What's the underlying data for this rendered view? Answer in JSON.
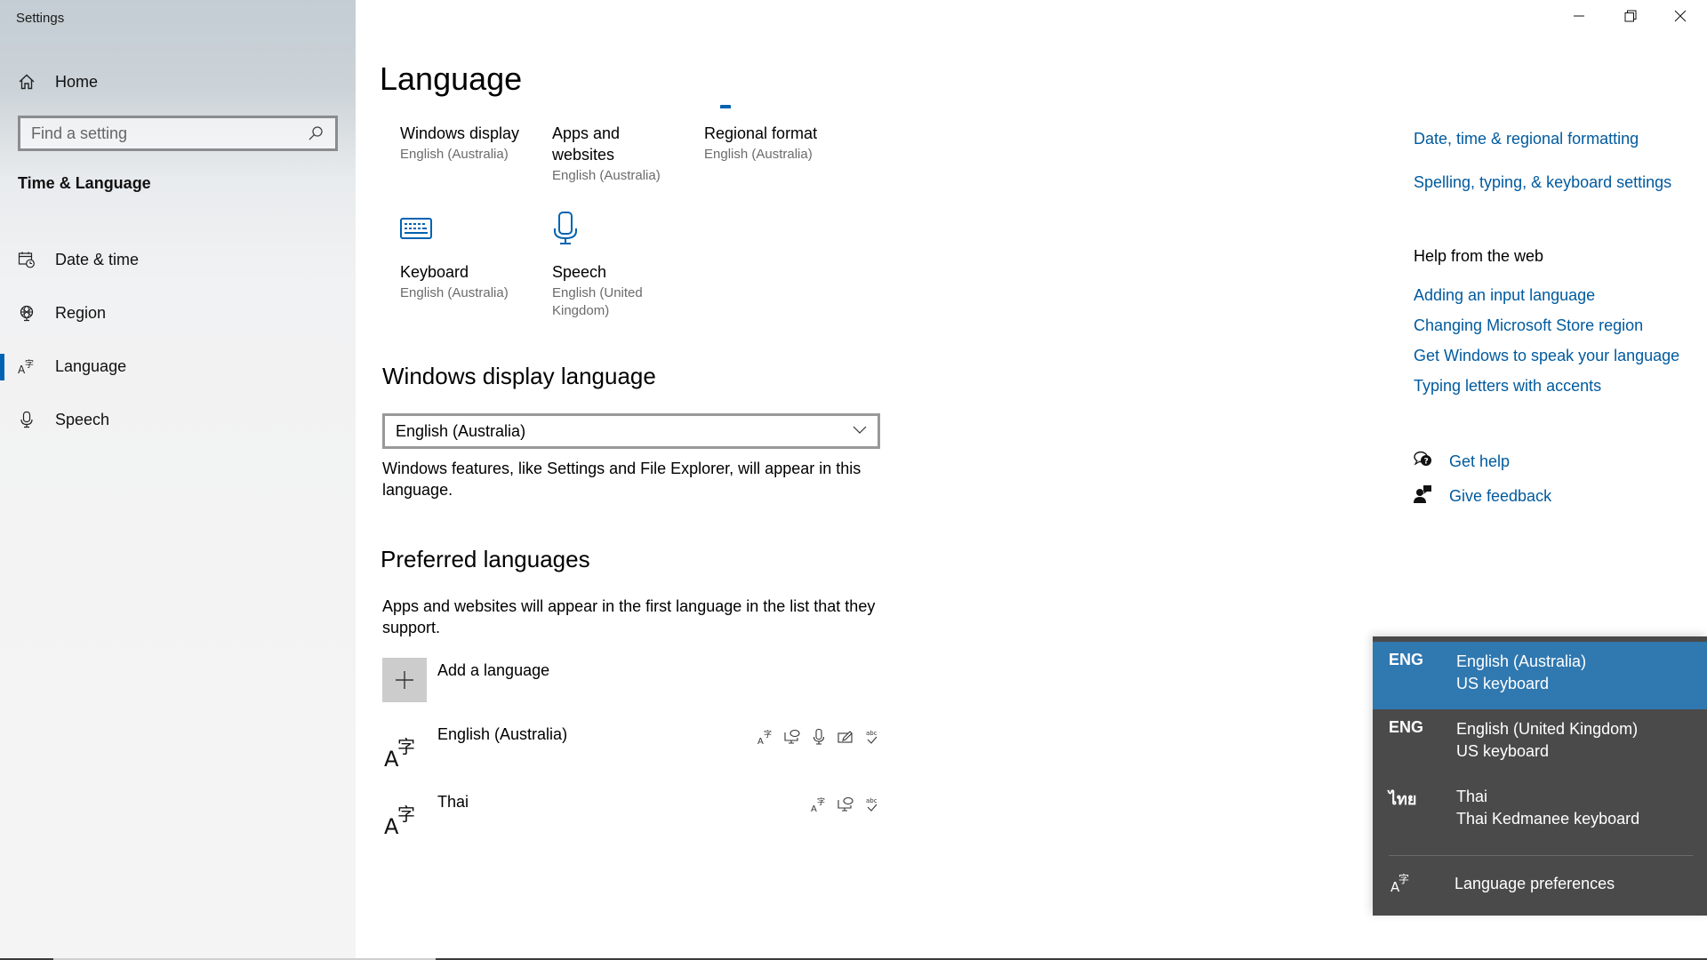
{
  "window": {
    "title": "Settings",
    "controls": {
      "minimize": "minimize-icon",
      "restore": "restore-icon",
      "close": "close-icon"
    }
  },
  "sidebar": {
    "home_label": "Home",
    "search_placeholder": "Find a setting",
    "section_title": "Time & Language",
    "items": [
      {
        "label": "Date & time",
        "icon": "calendar-clock-icon",
        "active": false
      },
      {
        "label": "Region",
        "icon": "globe-icon",
        "active": false
      },
      {
        "label": "Language",
        "icon": "language-icon",
        "active": true
      },
      {
        "label": "Speech",
        "icon": "microphone-icon",
        "active": false
      }
    ]
  },
  "main": {
    "page_title": "Language",
    "tiles": [
      {
        "title": "Windows display",
        "subtitle": "English (Australia)"
      },
      {
        "title": "Apps and websites",
        "subtitle": "English (Australia)"
      },
      {
        "title": "Regional format",
        "subtitle": "English (Australia)"
      },
      {
        "title": "Keyboard",
        "subtitle": "English (Australia)",
        "icon": "keyboard-icon"
      },
      {
        "title": "Speech",
        "subtitle": "English (United Kingdom)",
        "icon": "microphone-icon"
      }
    ],
    "display_language": {
      "heading": "Windows display language",
      "selected": "English (Australia)",
      "description": "Windows features, like Settings and File Explorer, will appear in this language."
    },
    "preferred": {
      "heading": "Preferred languages",
      "description": "Apps and websites will appear in the first language in the list that they support.",
      "add_label": "Add a language",
      "languages": [
        {
          "name": "English (Australia)",
          "features": [
            "display-language-icon",
            "text-to-speech-icon",
            "speech-recognition-icon",
            "handwriting-icon",
            "spell-check-icon"
          ]
        },
        {
          "name": "Thai",
          "features": [
            "display-language-icon",
            "text-to-speech-icon",
            "spell-check-icon"
          ]
        }
      ]
    }
  },
  "related": {
    "links": [
      "Date, time & regional formatting",
      "Spelling, typing, & keyboard settings"
    ],
    "help_heading": "Help from the web",
    "help_links": [
      "Adding an input language",
      "Changing Microsoft Store region",
      "Get Windows to speak your language",
      "Typing letters with accents"
    ],
    "get_help": "Get help",
    "give_feedback": "Give feedback"
  },
  "flyout": {
    "items": [
      {
        "abbr": "ENG",
        "language": "English (Australia)",
        "keyboard": "US keyboard",
        "selected": true
      },
      {
        "abbr": "ENG",
        "language": "English (United Kingdom)",
        "keyboard": "US keyboard",
        "selected": false
      },
      {
        "abbr": "ไทย",
        "language": "Thai",
        "keyboard": "Thai Kedmanee keyboard",
        "selected": false
      }
    ],
    "preferences_label": "Language preferences"
  },
  "colors": {
    "accent": "#0063b1",
    "link": "#005a9e",
    "flyout_bg": "#4a4a4a",
    "flyout_selected": "#3078b0"
  }
}
